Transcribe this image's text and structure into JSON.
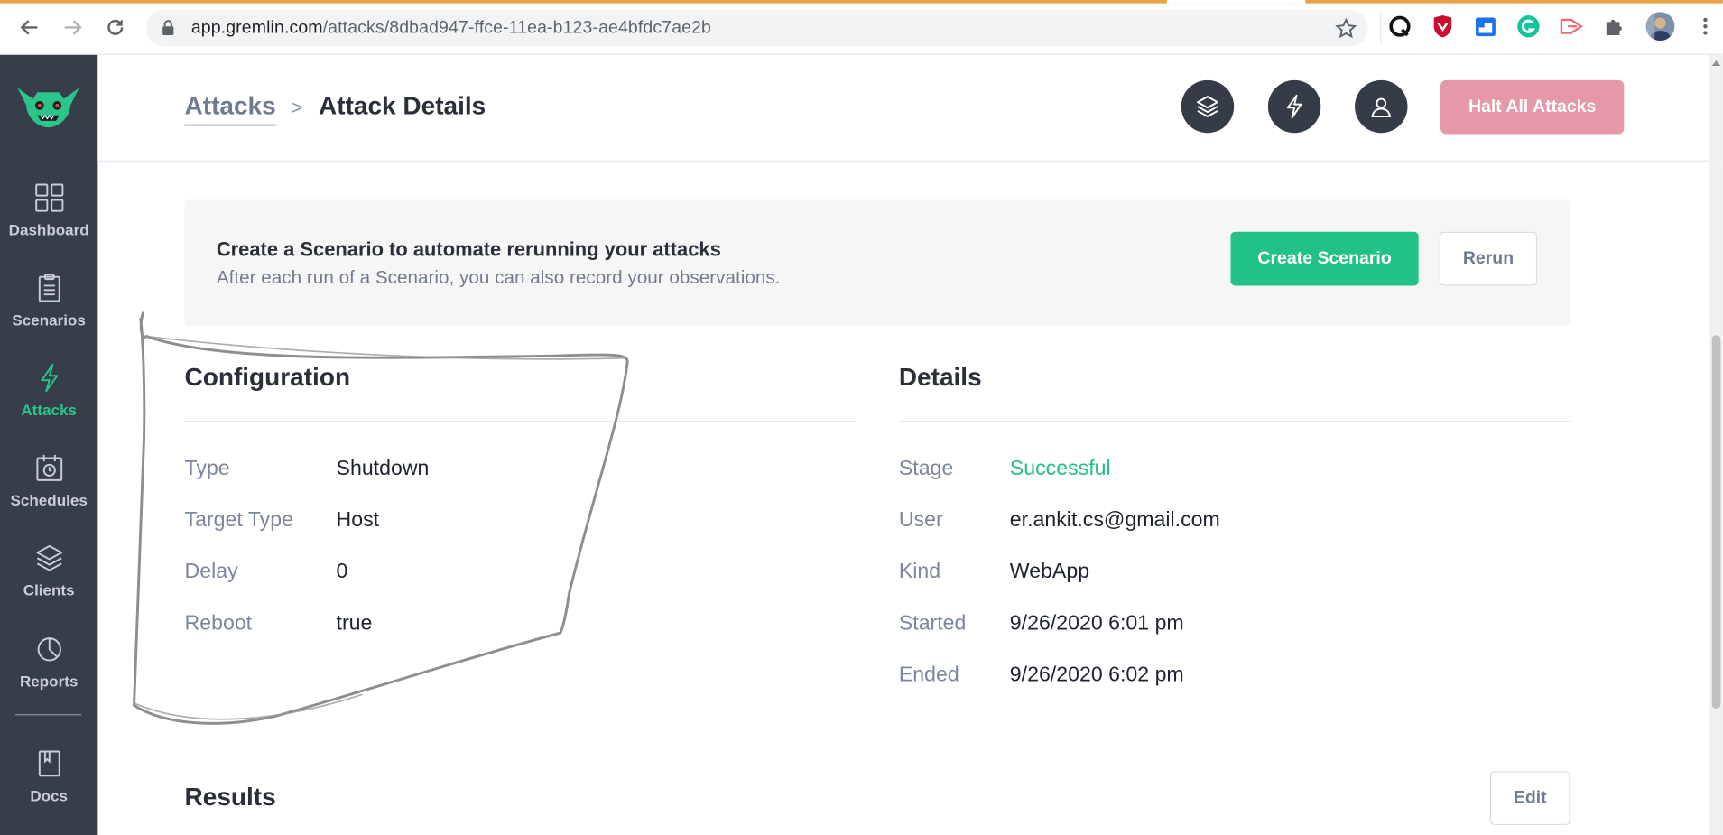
{
  "browser": {
    "url_host": "app.gremlin.com",
    "url_path": "/attacks/8dbad947-ffce-11ea-b123-ae4bfdc7ae2b",
    "icons": [
      "back-arrow-icon",
      "forward-arrow-icon",
      "reload-icon",
      "lock-icon",
      "bookmark-star-icon",
      "extensions-puzzle-icon",
      "profile-avatar"
    ]
  },
  "sidebar": {
    "items": [
      {
        "label": "Dashboard",
        "icon": "dashboard-grid-icon"
      },
      {
        "label": "Scenarios",
        "icon": "clipboard-icon"
      },
      {
        "label": "Attacks",
        "icon": "lightning-icon",
        "active": true
      },
      {
        "label": "Schedules",
        "icon": "calendar-clock-icon"
      },
      {
        "label": "Clients",
        "icon": "layers-icon"
      },
      {
        "label": "Reports",
        "icon": "pie-chart-icon"
      },
      {
        "label": "Docs",
        "icon": "book-icon"
      }
    ]
  },
  "header": {
    "breadcrumb_parent": "Attacks",
    "breadcrumb_separator": ">",
    "breadcrumb_current": "Attack Details",
    "halt_label": "Halt All Attacks"
  },
  "banner": {
    "title": "Create a Scenario to automate rerunning your attacks",
    "subtitle": "After each run of a Scenario, you can also record your observations.",
    "create_label": "Create Scenario",
    "rerun_label": "Rerun"
  },
  "configuration": {
    "title": "Configuration",
    "rows": [
      {
        "key": "Type",
        "value": "Shutdown"
      },
      {
        "key": "Target Type",
        "value": "Host"
      },
      {
        "key": "Delay",
        "value": "0"
      },
      {
        "key": "Reboot",
        "value": "true"
      }
    ]
  },
  "details": {
    "title": "Details",
    "rows": [
      {
        "key": "Stage",
        "value": "Successful"
      },
      {
        "key": "User",
        "value": "er.ankit.cs@gmail.com"
      },
      {
        "key": "Kind",
        "value": "WebApp"
      },
      {
        "key": "Started",
        "value": "9/26/2020 6:01 pm"
      },
      {
        "key": "Ended",
        "value": "9/26/2020 6:02 pm"
      }
    ]
  },
  "results": {
    "title": "Results",
    "edit_label": "Edit"
  },
  "colors": {
    "sidebar_bg": "#373d49",
    "accent_green": "#22c185",
    "halt_pink": "#e598a8",
    "text_dark": "#2a2f3a",
    "text_muted": "#7d879a"
  }
}
